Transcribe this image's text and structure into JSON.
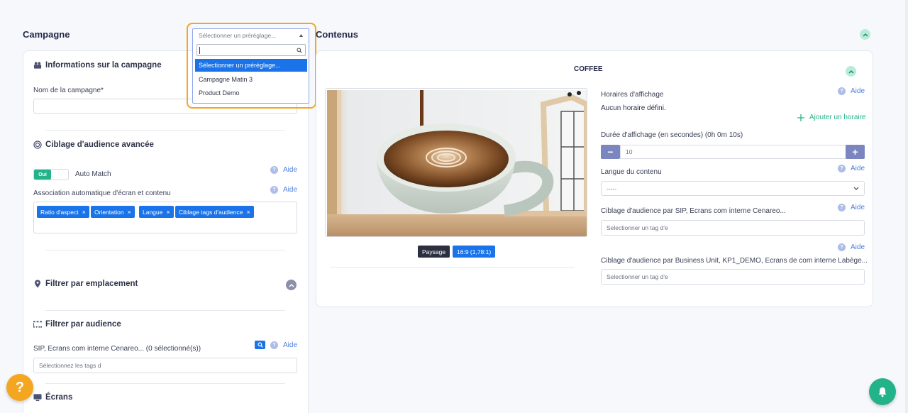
{
  "left": {
    "title": "Campagne",
    "info_header": "Informations sur la campagne",
    "name_label": "Nom de la campagne*",
    "name_value": "",
    "audience_header": "Ciblage d'audience avancée",
    "toggle_on": "Oui",
    "auto_match_label": "Auto Match",
    "help_label": "Aide",
    "association_label": "Association automatique d'écran et contenu",
    "tags": [
      "Ratio d'aspect",
      "Orientation",
      "Langue",
      "Ciblage tags d'audience"
    ],
    "tag_remove": "×",
    "location_header": "Filtrer par emplacement",
    "audience_filter_header": "Filtrer par audience",
    "sip_label": "SIP, Ecrans com interne Cenareo... (0 sélectionné(s))",
    "sip_placeholder": "Sélectionnez les tags d",
    "screens_header": "Écrans"
  },
  "preset": {
    "selected": "Sélectionner un préréglage...",
    "search_value": "",
    "options": [
      "Sélectionner un préréglage...",
      "Campagne Matin 3",
      "Product Demo"
    ]
  },
  "right": {
    "title": "Contenus",
    "content_name": "COFFEE",
    "orientation_badge": "Paysage",
    "ratio_badge": "16:9 (1,78:1)",
    "schedule_label": "Horaires d'affichage",
    "schedule_value": "Aucun horaire défini.",
    "add_schedule": "Ajouter un horaire",
    "duration_label": "Durée d'affichage (en secondes) (0h 0m 10s)",
    "duration_value": "10",
    "minus": "−",
    "plus": "+",
    "language_label": "Langue du contenu",
    "language_value": "-----",
    "sip_label": "Ciblage d'audience par SIP, Ecrans com interne Cenareo...",
    "sip_placeholder": "Selectionner un tag d'e",
    "bu_label": "Ciblage d'audience par Business Unit, KP1_DEMO, Ecrans de com interne Labège...",
    "bu_placeholder": "Selectionner un tag d'e",
    "help_label": "Aide"
  },
  "fab": {
    "help": "?"
  },
  "colors": {
    "accent": "#1a73e8",
    "green": "#23b38a",
    "orange": "#f4a621",
    "navy": "#242a4a"
  }
}
